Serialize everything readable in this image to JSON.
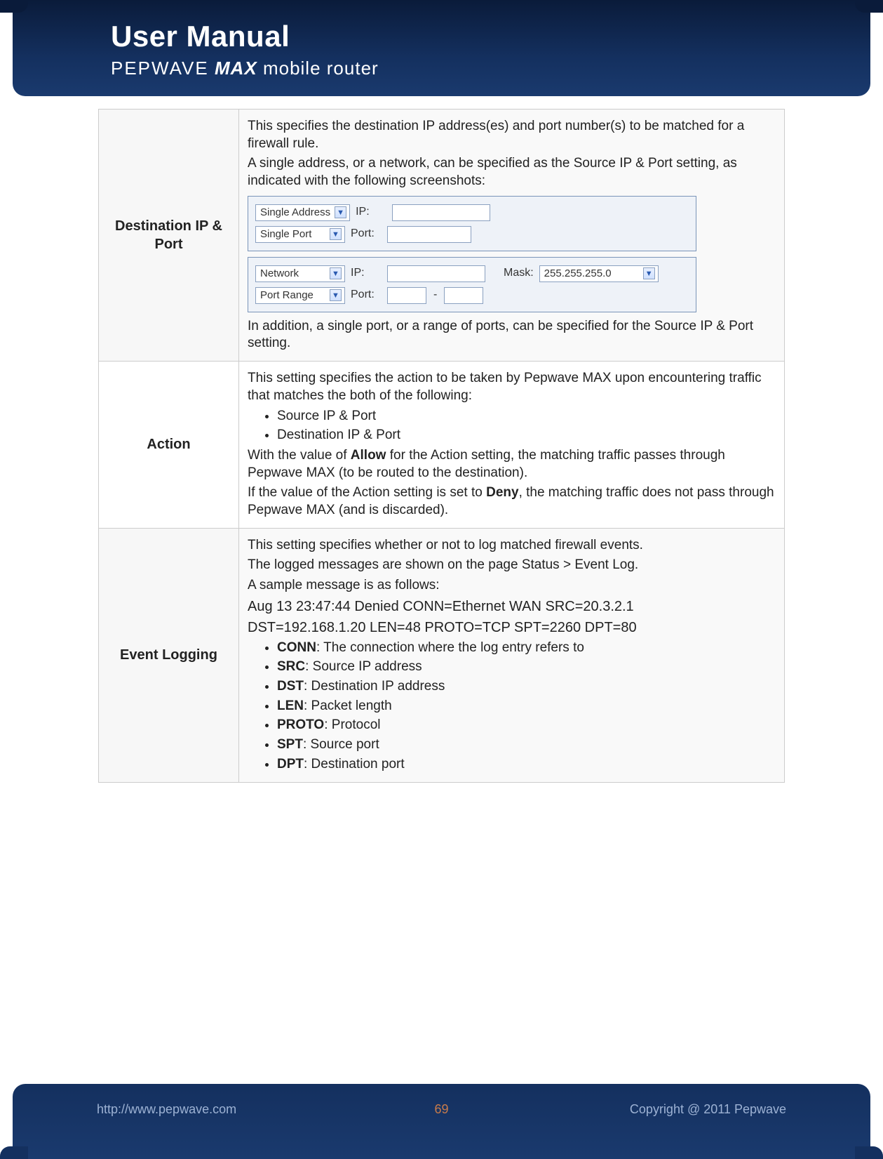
{
  "header": {
    "title": "User Manual",
    "brand": "PEPWAVE",
    "product": "MAX",
    "tag": "mobile router"
  },
  "rows": {
    "dest": {
      "label": "Destination IP & Port",
      "p1": "This specifies the destination IP address(es) and port number(s) to be matched for a firewall rule.",
      "p2": "A single address, or a network, can be specified as the Source IP & Port setting, as indicated with the following screenshots:",
      "p3": "In addition, a single port, or a range of ports, can be specified for the Source IP & Port setting.",
      "ui": {
        "single_address": "Single Address",
        "single_port": "Single Port",
        "network": "Network",
        "port_range": "Port Range",
        "ip_label": "IP:",
        "port_label": "Port:",
        "mask_label": "Mask:",
        "mask_value": "255.255.255.0"
      }
    },
    "action": {
      "label": "Action",
      "p1": "This setting specifies the action to be taken by Pepwave MAX upon encountering traffic that matches the both of the following:",
      "b1": "Source IP & Port",
      "b2": "Destination IP & Port",
      "p2a": "With the value of ",
      "p2b": "Allow",
      "p2c": " for the Action setting, the matching traffic passes through Pepwave MAX (to be routed to the destination).",
      "p3a": "If the value of the Action setting is set to ",
      "p3b": "Deny",
      "p3c": ", the matching traffic does not pass through Pepwave MAX (and is discarded)."
    },
    "log": {
      "label": "Event Logging",
      "p1": "This setting specifies whether or not to log matched firewall events.",
      "p2": "The logged messages are shown on the page Status > Event Log.",
      "p3": "A sample message is as follows:",
      "s1": "Aug 13 23:47:44 Denied CONN=Ethernet WAN SRC=20.3.2.1",
      "s2": "DST=192.168.1.20 LEN=48 PROTO=TCP SPT=2260 DPT=80",
      "items": [
        {
          "k": "CONN",
          "v": ":  The connection where the log entry refers to"
        },
        {
          "k": "SRC",
          "v": ":  Source IP address"
        },
        {
          "k": "DST",
          "v": ":  Destination IP address"
        },
        {
          "k": "LEN",
          "v": ":  Packet length"
        },
        {
          "k": "PROTO",
          "v": ":  Protocol"
        },
        {
          "k": "SPT",
          "v": ":  Source port"
        },
        {
          "k": "DPT",
          "v": ":  Destination port"
        }
      ]
    }
  },
  "footer": {
    "url": "http://www.pepwave.com",
    "page": "69",
    "copy": "Copyright @ 2011 Pepwave"
  }
}
